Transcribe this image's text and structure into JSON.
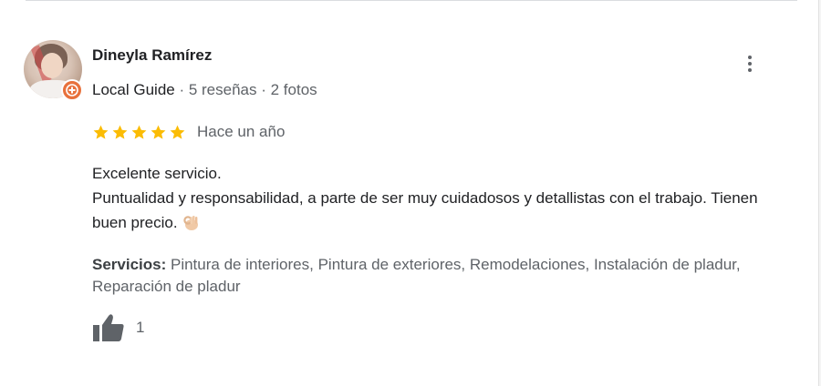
{
  "review": {
    "author": {
      "name": "Dineyla Ramírez",
      "badge_icon": "local-guide-badge-icon",
      "local_guide_label": "Local Guide",
      "separator": " · ",
      "reviews_count": "5 reseñas",
      "photos_count": "2 fotos"
    },
    "rating": {
      "stars": 5,
      "max_stars": 5,
      "star_color": "#fbbc04"
    },
    "date": "Hace un año",
    "text_lines": [
      "Excelente servicio.",
      "Puntualidad y responsabilidad, a parte de ser muy cuidadosos y detallistas con el trabajo. Tienen buen precio."
    ],
    "emoji": "ok-hand-emoji",
    "services": {
      "label": "Servicios:",
      "value": " Pintura de interiores, Pintura de exteriores, Remodelaciones, Instalación de pladur, Reparación de pladur"
    },
    "likes": {
      "icon": "thumbs-up-icon",
      "count": "1"
    },
    "more_icon": "more-vert-icon"
  },
  "colors": {
    "badge": "#e8713c",
    "text_primary": "#202124",
    "text_secondary": "#5f6368",
    "icon": "#5f6368"
  }
}
